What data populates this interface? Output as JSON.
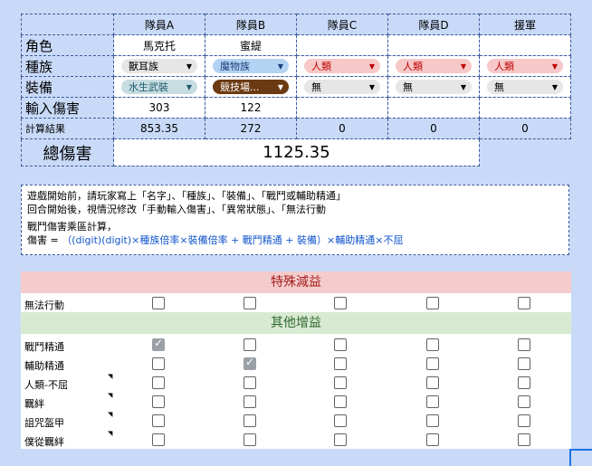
{
  "headers": [
    "",
    "隊員A",
    "隊員B",
    "隊員C",
    "隊員D",
    "援軍"
  ],
  "rows": {
    "name": {
      "label": "角色",
      "values": [
        "馬克托",
        "蜜緹",
        "",
        "",
        ""
      ]
    },
    "race": {
      "label": "種族",
      "chips": [
        {
          "text": "獸耳族",
          "style": "grey"
        },
        {
          "text": "魔物族",
          "style": "blue"
        },
        {
          "text": "人類",
          "style": "red"
        },
        {
          "text": "人類",
          "style": "red"
        },
        {
          "text": "人類",
          "style": "red"
        }
      ]
    },
    "equip": {
      "label": "裝備",
      "chips": [
        {
          "text": "水生武裝",
          "style": "teal"
        },
        {
          "text": "競技場...",
          "style": "brown"
        },
        {
          "text": "無",
          "style": "dd"
        },
        {
          "text": "無",
          "style": "dd"
        },
        {
          "text": "無",
          "style": "dd"
        }
      ]
    },
    "input": {
      "label": "輸入傷害",
      "values": [
        "303",
        "122",
        "",
        "",
        ""
      ]
    },
    "calc": {
      "label": "計算結果",
      "values": [
        "853.35",
        "272",
        "0",
        "0",
        "0"
      ]
    }
  },
  "total": {
    "label": "總傷害",
    "value": "1125.35"
  },
  "notes": {
    "line1": "遊戲開始前，請玩家寫上「名字」、「種族」、「裝備」、「戰鬥或輔助精通」",
    "line2": "回合開始後，視情況修改「手動輸入傷害」、「異常狀態」、「無法行動",
    "line3": "戰鬥傷害乘區計算，",
    "line4_prefix": "傷害 = ",
    "line4_formula": "（(digit)(digit)×種族倍率×裝備倍率 + 戰鬥精通 + 裝備）×輔助精通×不屈"
  },
  "debuff_section": {
    "title": "特殊減益",
    "rows": [
      {
        "label": "無法行動",
        "checks": [
          false,
          false,
          false,
          false,
          false
        ],
        "corner": false
      }
    ]
  },
  "buff_section": {
    "title": "其他增益",
    "rows": [
      {
        "label": "戰鬥精通",
        "checks": [
          true,
          false,
          false,
          false,
          false
        ],
        "corner": false
      },
      {
        "label": "輔助精通",
        "checks": [
          false,
          true,
          false,
          false,
          false
        ],
        "corner": false
      },
      {
        "label": "人類-不屈",
        "checks": [
          false,
          false,
          false,
          false,
          false
        ],
        "corner": true
      },
      {
        "label": "羈絆",
        "checks": [
          false,
          false,
          false,
          false,
          false
        ],
        "corner": true
      },
      {
        "label": "詛咒盔甲",
        "checks": [
          false,
          false,
          false,
          false,
          false
        ],
        "corner": true
      },
      {
        "label": "僕從羈絆",
        "checks": [
          false,
          false,
          false,
          false,
          false
        ],
        "corner": true
      }
    ]
  },
  "icons": {
    "dropdown_arrow": "▼",
    "check": "✓",
    "comment_marker": "◥"
  }
}
